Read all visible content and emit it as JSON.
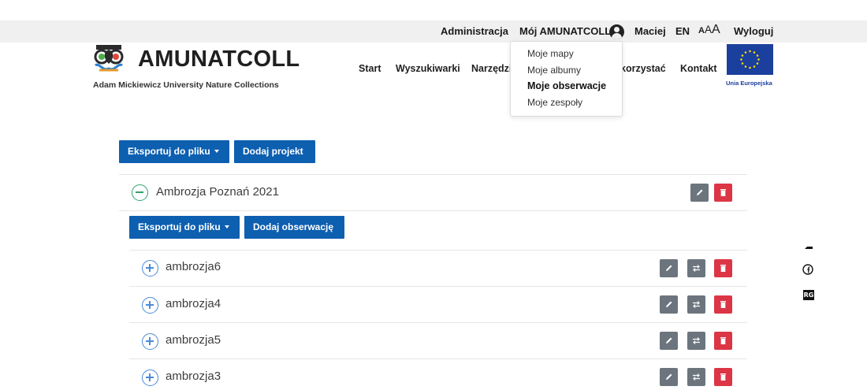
{
  "topbar": {
    "admin": "Administracja",
    "my": "Mój AMUNATCOLL",
    "user": "Maciej",
    "lang": "EN",
    "font_size": [
      "A",
      "A",
      "A"
    ],
    "logout": "Wyloguj"
  },
  "logo": {
    "title": "AMUNATCOLL",
    "subtitle": "Adam Mickiewicz University Nature Collections"
  },
  "nav": {
    "items": [
      "Start",
      "Wyszukiwarki",
      "Narzędzi",
      "korzystać",
      "Kontakt"
    ]
  },
  "eu": {
    "label": "Unia Europejska"
  },
  "dropdown": {
    "items": [
      "Moje mapy",
      "Moje albumy",
      "Moje obserwacje",
      "Moje zespoły"
    ],
    "active": "Moje obserwacje"
  },
  "toolbar": {
    "export_label": "Eksportuj do pliku",
    "add_project_label": "Dodaj projekt"
  },
  "project": {
    "name": "Ambrozja Poznań 2021",
    "export_label": "Eksportuj do pliku",
    "add_observation_label": "Dodaj obserwację",
    "observations": [
      "ambrozja6",
      "ambrozja4",
      "ambrozja5",
      "ambrozja3"
    ]
  },
  "side_icons": [
    "orcid-icon",
    "facebook-icon",
    "researchgate-icon"
  ],
  "rg_text": "RG",
  "colors": {
    "primary": "#0d5fb0",
    "danger": "#dc3545",
    "secondary": "#6c757d",
    "collapse": "#2fa36b",
    "expand": "#4a8ad6",
    "eu_blue": "#1b3f9c"
  }
}
